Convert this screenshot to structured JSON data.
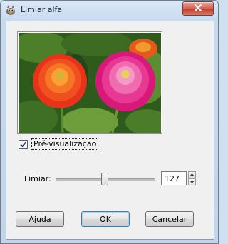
{
  "window": {
    "title": "Limiar alfa",
    "icon": "gimp-wilber-icon",
    "close_icon": "close-x-icon"
  },
  "preview": {
    "image": "flowers-preview-image",
    "checkbox_label": "Pré-visualização",
    "checkbox_checked": true
  },
  "threshold": {
    "label": "Limiar:",
    "value": "127",
    "max": 255
  },
  "buttons": {
    "help": "Ajuda",
    "ok": "OK",
    "cancel": "Cancelar"
  },
  "colors": {
    "default_button_border": "#3c7fb1",
    "close_button": "#c0392b"
  }
}
